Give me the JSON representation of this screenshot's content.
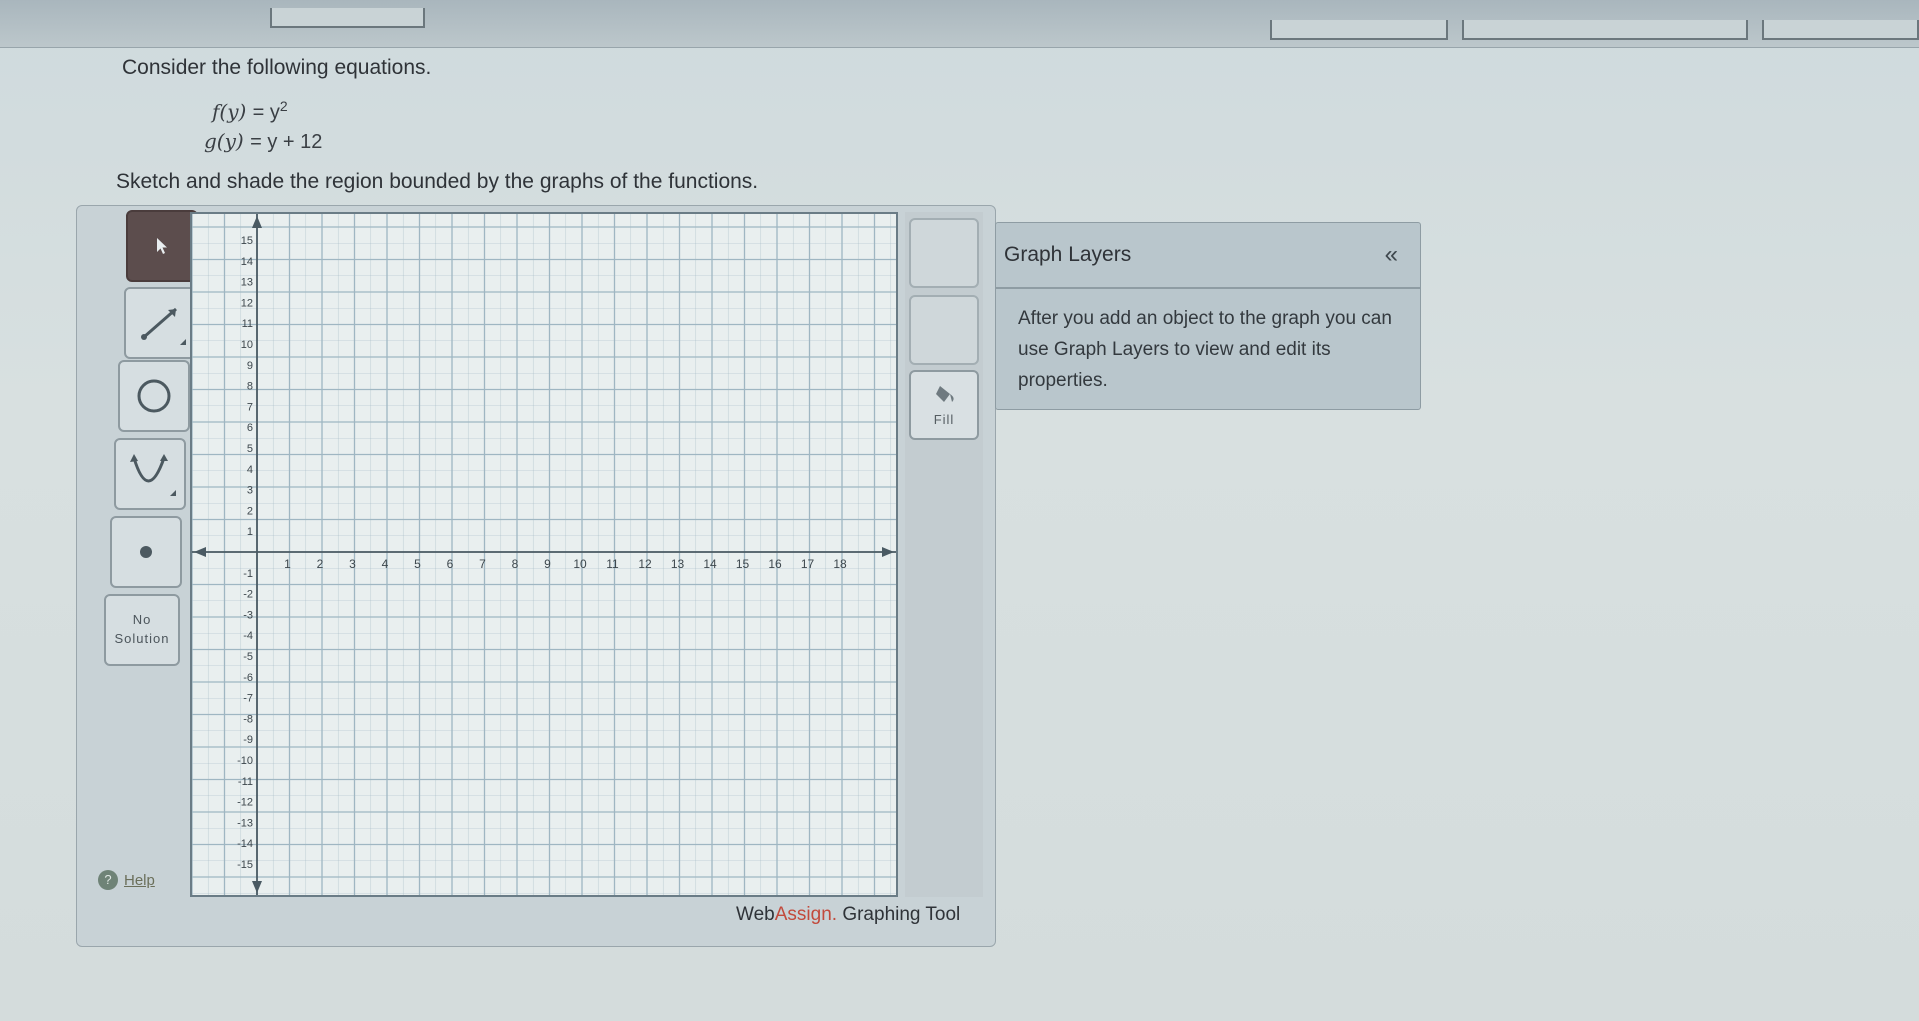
{
  "question": {
    "intro": "Consider the following equations.",
    "eq1": {
      "lhs": "f(y)",
      "rhs": "= y",
      "exp": "2"
    },
    "eq2": {
      "lhs": "g(y)",
      "rhs": "= y + 12"
    },
    "instruction": "Sketch and shade the region bounded by the graphs of the functions."
  },
  "toolbar": {
    "tools": [
      "pointer-icon",
      "line-tool-icon",
      "circle-tool-icon",
      "parabola-tool-icon",
      "point-tool-icon"
    ],
    "no_solution": [
      "No",
      "Solution"
    ],
    "help": "Help"
  },
  "graph": {
    "x_ticks": [
      "1",
      "2",
      "3",
      "4",
      "5",
      "6",
      "7",
      "8",
      "9",
      "10",
      "11",
      "12",
      "13",
      "14",
      "15",
      "16",
      "17",
      "18"
    ],
    "y_ticks_pos": [
      "15",
      "14",
      "13",
      "12",
      "11",
      "10",
      "9",
      "8",
      "7",
      "6",
      "5",
      "4",
      "3",
      "2",
      "1"
    ],
    "y_ticks_neg": [
      "-1",
      "-2",
      "-3",
      "-4",
      "-5",
      "-6",
      "-7",
      "-8",
      "-9",
      "-10",
      "-11",
      "-12",
      "-13",
      "-14",
      "-15"
    ]
  },
  "side_buttons": {
    "fill_label": "Fill"
  },
  "layers": {
    "title": "Graph Layers",
    "collapse": "«",
    "body": "After you add an object to the graph you can use Graph Layers to view and edit its properties."
  },
  "brand": {
    "accent": "Assign.",
    "prefix": "Web",
    "suffix": " Graphing Tool"
  },
  "colors": {
    "accent": "#c24a3c",
    "active_tool": "#5c4d4d",
    "grid_line": "#9fb6c2"
  }
}
